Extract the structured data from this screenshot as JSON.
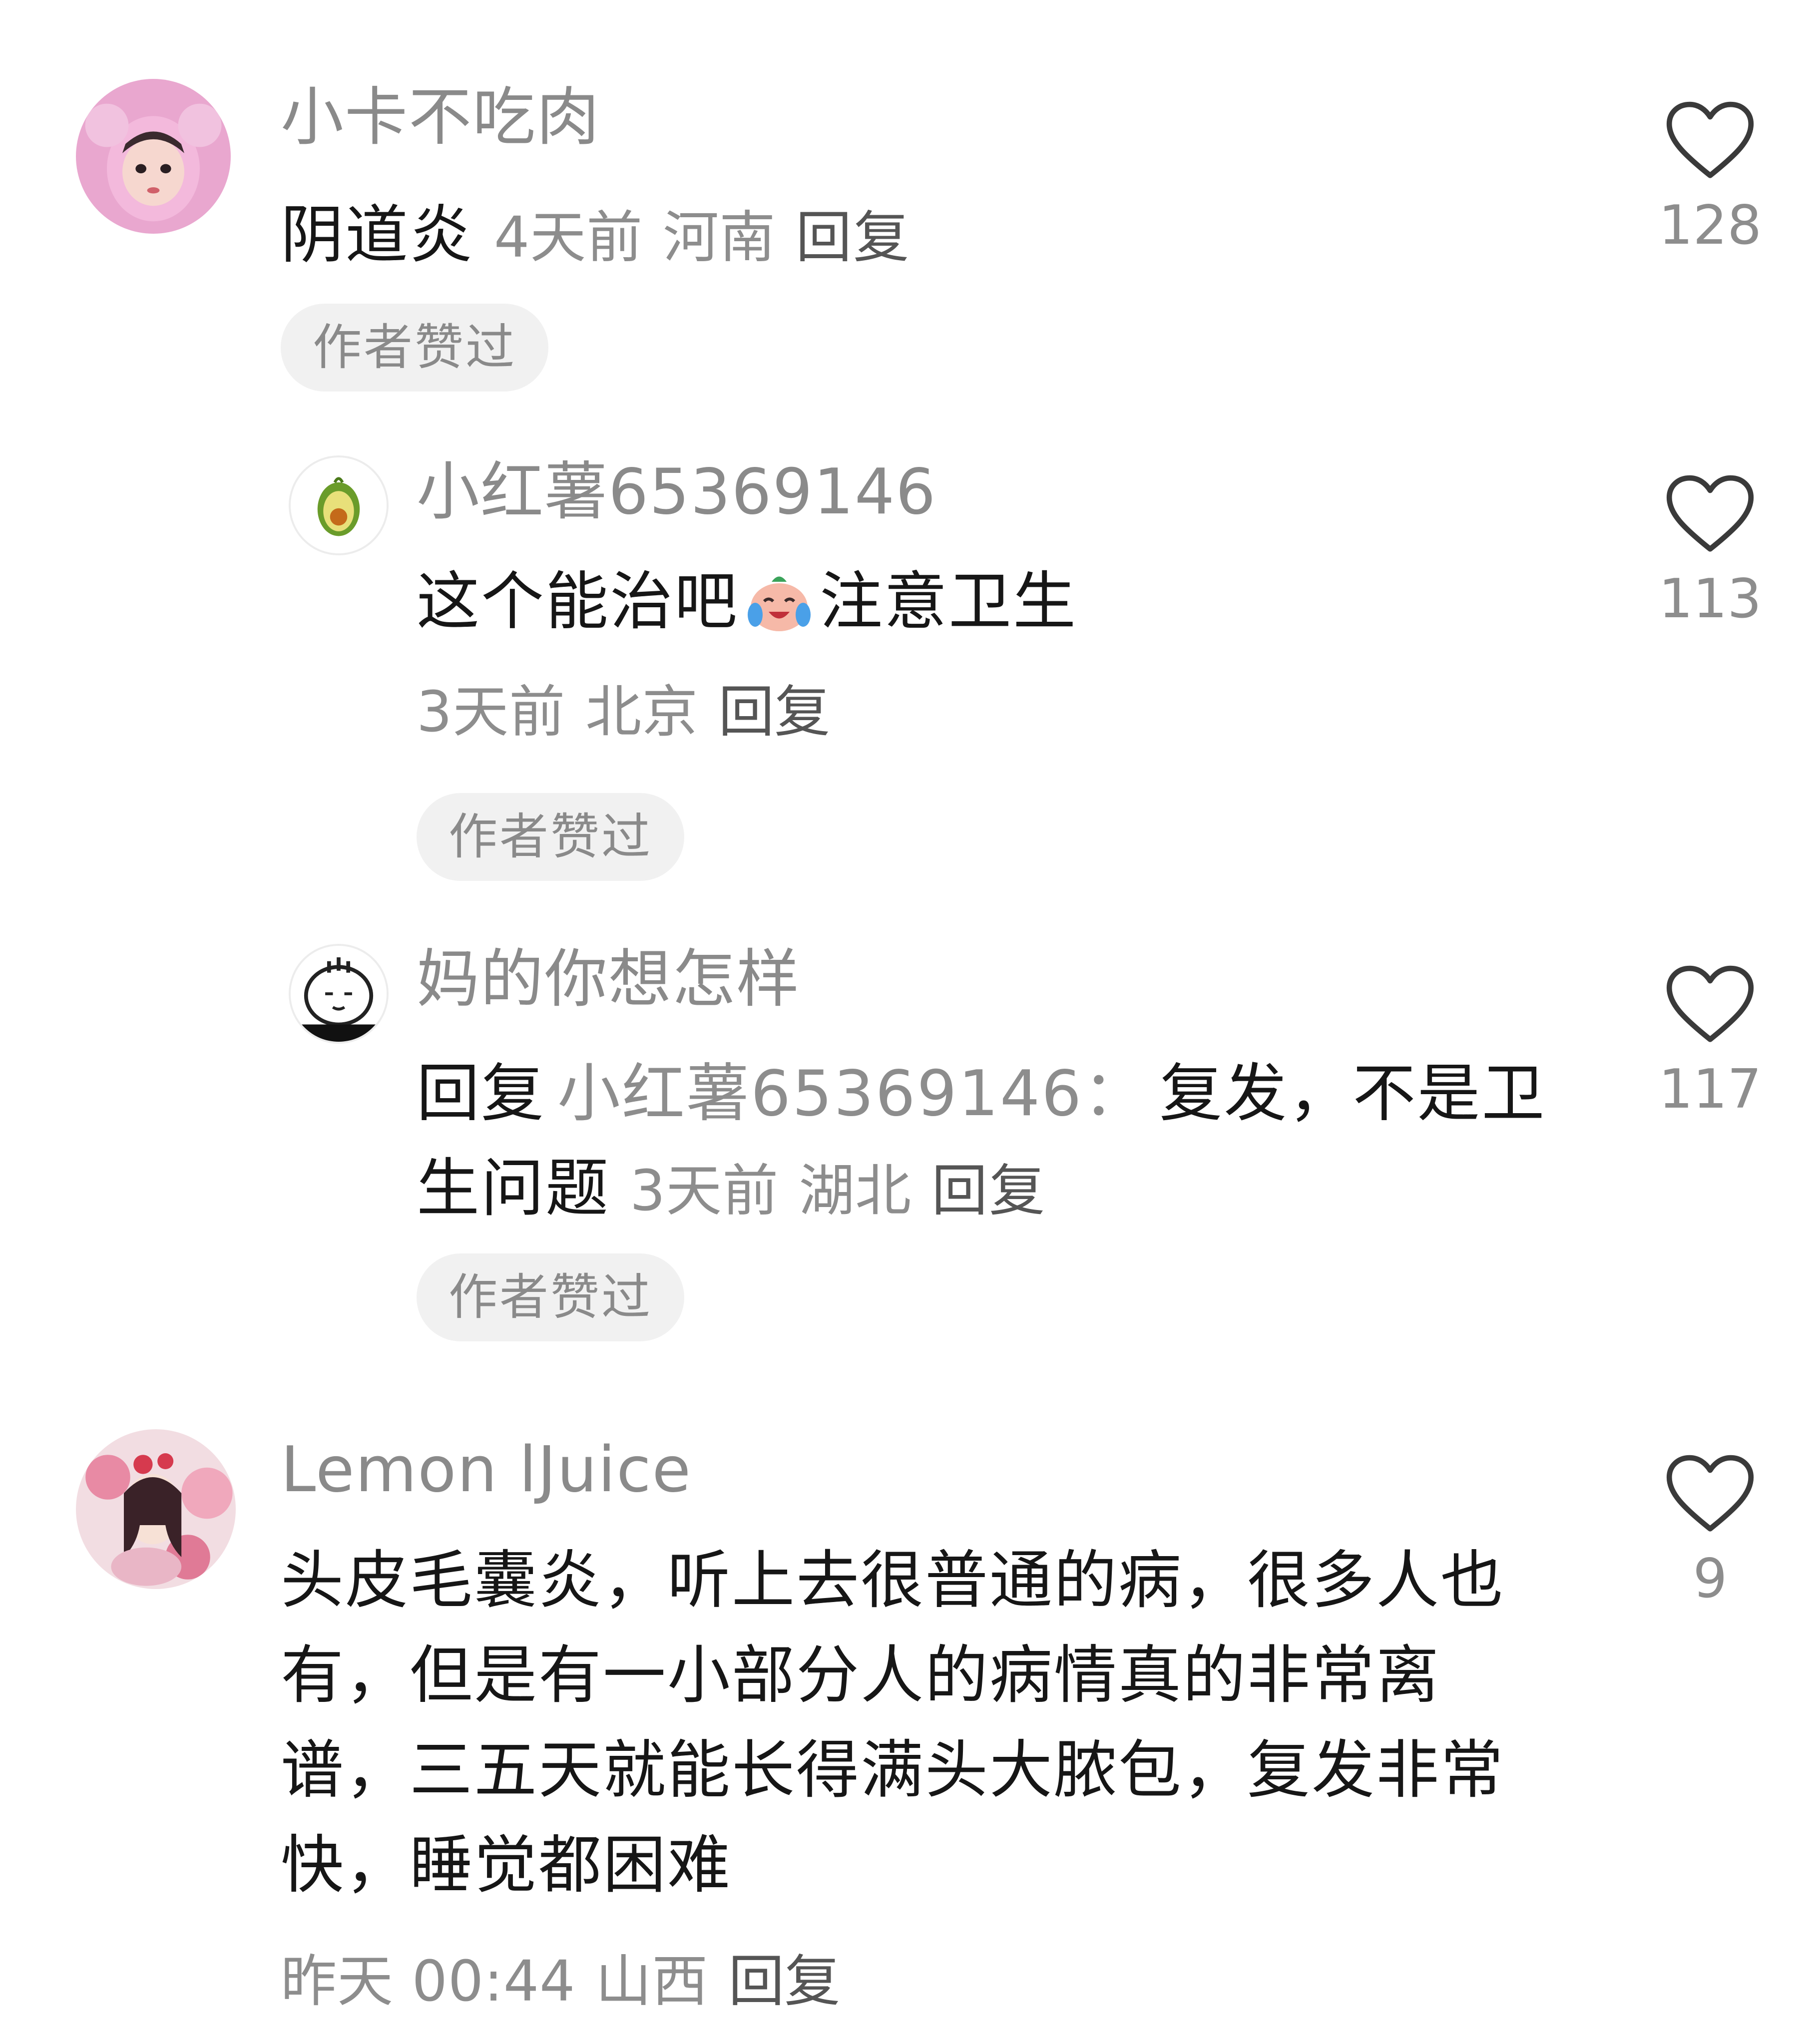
{
  "comments": [
    {
      "username": "小卡不吃肉",
      "text": "阴道炎",
      "time": "4天前",
      "location": "河南",
      "reply_label": "回复",
      "badge": "作者赞过",
      "likes": "128",
      "avatar_icon": "girl-pink-hood-avatar"
    },
    {
      "username": "小红薯65369146",
      "text_before_emoji": "这个能治吧",
      "emoji_icon": "crying-laughing-emoji",
      "text_after_emoji": "注意卫生",
      "time": "3天前",
      "location": "北京",
      "reply_label": "回复",
      "badge": "作者赞过",
      "likes": "113",
      "avatar_icon": "avocado-avatar"
    },
    {
      "username": "妈的你想怎样",
      "reply_prefix": "回复",
      "reply_target": "小红薯65369146：",
      "text": "复发，不是卫生问题",
      "time": "3天前",
      "location": "湖北",
      "reply_label": "回复",
      "badge": "作者赞过",
      "likes": "117",
      "avatar_icon": "cartoon-face-avatar"
    },
    {
      "username": "Lemon lJuice",
      "text": "头皮毛囊炎，听上去很普通的病，很多人也有，但是有一小部分人的病情真的非常离谱，三五天就能长得满头大脓包，复发非常快，睡觉都困难",
      "time": "昨天 00:44",
      "location": "山西",
      "reply_label": "回复",
      "likes": "9",
      "avatar_icon": "anime-girl-flowers-avatar"
    }
  ],
  "colors": {
    "secondary_text": "#8d8d8d",
    "badge_bg": "#f1f1f1",
    "heart_outline": "#3a3a3a"
  }
}
